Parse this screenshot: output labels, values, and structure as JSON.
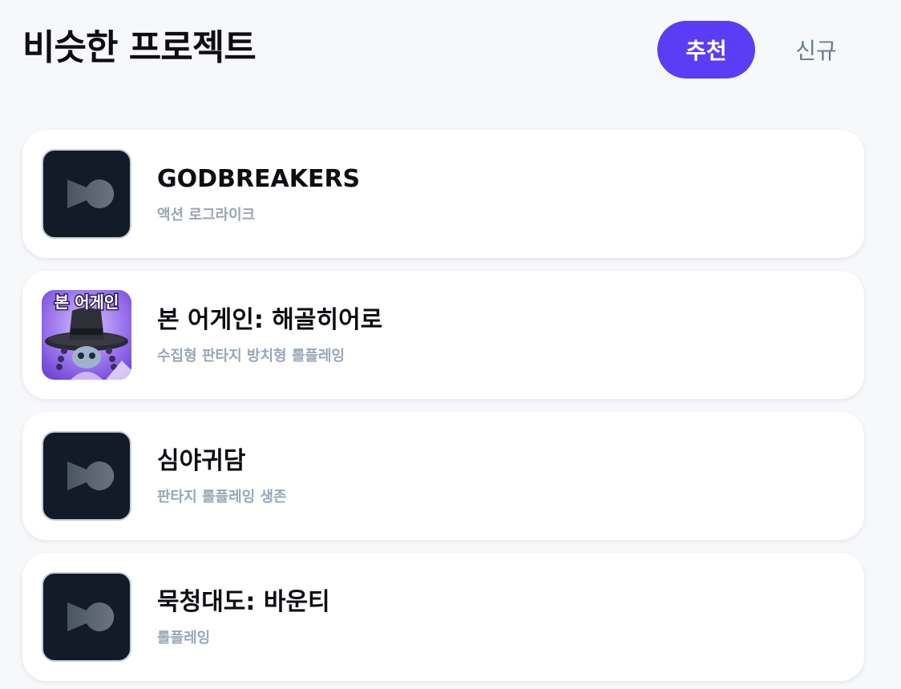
{
  "header": {
    "title": "비슷한 프로젝트",
    "tabs": [
      {
        "label": "추천",
        "active": true
      },
      {
        "label": "신규",
        "active": false
      }
    ]
  },
  "projects": [
    {
      "name": "GODBREAKERS",
      "tags": "액션 로그라이크",
      "thumbnail": "placeholder-play-icon"
    },
    {
      "name": "본 어게인: 해골히어로",
      "tags": "수집형 판타지 방치형 롤플레잉",
      "thumbnail": "game-art",
      "art_text": "본 어게인"
    },
    {
      "name": "심야귀담",
      "tags": "판타지 롤플레잉 생존",
      "thumbnail": "placeholder-play-icon"
    },
    {
      "name": "묵청대도: 바운티",
      "tags": "롤플레잉",
      "thumbnail": "placeholder-play-icon"
    }
  ],
  "colors": {
    "accent": "#5b3df5",
    "placeholder_bg": "#131b28",
    "tag_text": "#9aa6b6",
    "inactive_tab": "#6c7a8c"
  }
}
